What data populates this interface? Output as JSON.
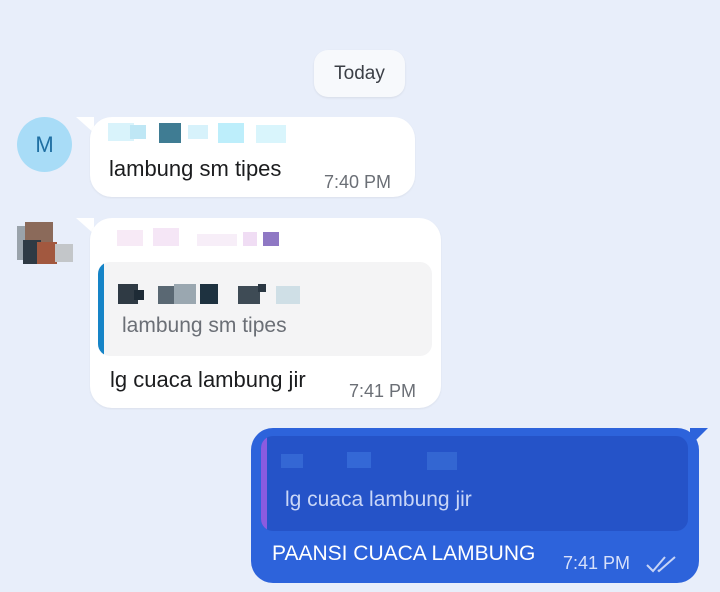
{
  "date_separator": "Today",
  "messages": [
    {
      "avatar_initial": "M",
      "text": "lambung sm tipes",
      "time": "7:40 PM"
    },
    {
      "reply_to_text": "lambung sm tipes",
      "text": "lg cuaca lambung jir",
      "time": "7:41 PM"
    }
  ],
  "outgoing": {
    "reply_to_text": "lg cuaca lambung jir",
    "text": "PAANSI CUACA LAMBUNG",
    "time": "7:41 PM",
    "status": "double-check-read-icon"
  },
  "colors": {
    "background": "#e8eefa",
    "incoming_bubble": "#ffffff",
    "outgoing_bubble": "#2d63db",
    "incoming_quote_bar": "#1684c7",
    "outgoing_quote_bar": "#8b5be0",
    "avatar_bg": "#a8dcf7"
  }
}
